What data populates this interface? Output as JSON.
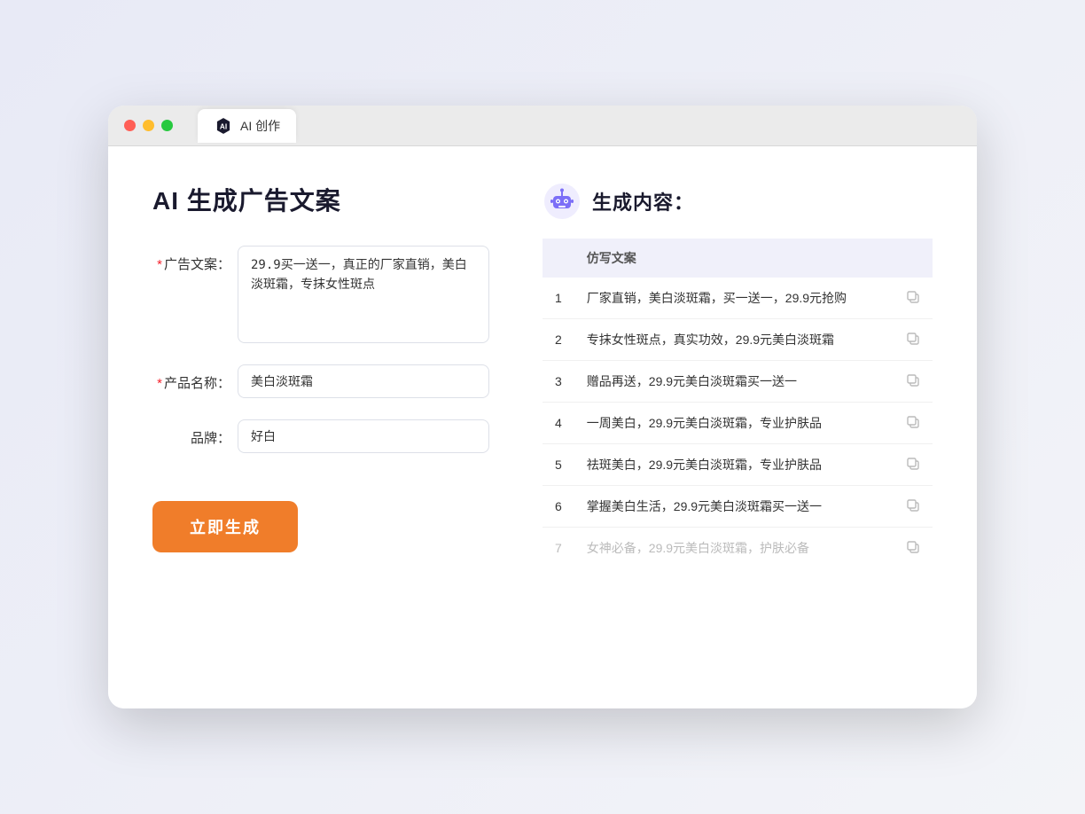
{
  "window": {
    "tab_label": "AI 创作"
  },
  "left": {
    "page_title": "AI 生成广告文案",
    "fields": [
      {
        "id": "ad_copy",
        "label": "广告文案：",
        "required": true,
        "type": "textarea",
        "value": "29.9买一送一，真正的厂家直销，美白淡斑霜，专抹女性斑点",
        "placeholder": ""
      },
      {
        "id": "product_name",
        "label": "产品名称：",
        "required": true,
        "type": "text",
        "value": "美白淡斑霜",
        "placeholder": ""
      },
      {
        "id": "brand",
        "label": "品牌：",
        "required": false,
        "type": "text",
        "value": "好白",
        "placeholder": ""
      }
    ],
    "generate_btn_label": "立即生成"
  },
  "right": {
    "title": "生成内容：",
    "table_header": "仿写文案",
    "results": [
      {
        "num": 1,
        "text": "厂家直销，美白淡斑霜，买一送一，29.9元抢购",
        "muted": false
      },
      {
        "num": 2,
        "text": "专抹女性斑点，真实功效，29.9元美白淡斑霜",
        "muted": false
      },
      {
        "num": 3,
        "text": "赠品再送，29.9元美白淡斑霜买一送一",
        "muted": false
      },
      {
        "num": 4,
        "text": "一周美白，29.9元美白淡斑霜，专业护肤品",
        "muted": false
      },
      {
        "num": 5,
        "text": "祛斑美白，29.9元美白淡斑霜，专业护肤品",
        "muted": false
      },
      {
        "num": 6,
        "text": "掌握美白生活，29.9元美白淡斑霜买一送一",
        "muted": false
      },
      {
        "num": 7,
        "text": "女神必备，29.9元美白淡斑霜，护肤必备",
        "muted": true
      }
    ]
  }
}
